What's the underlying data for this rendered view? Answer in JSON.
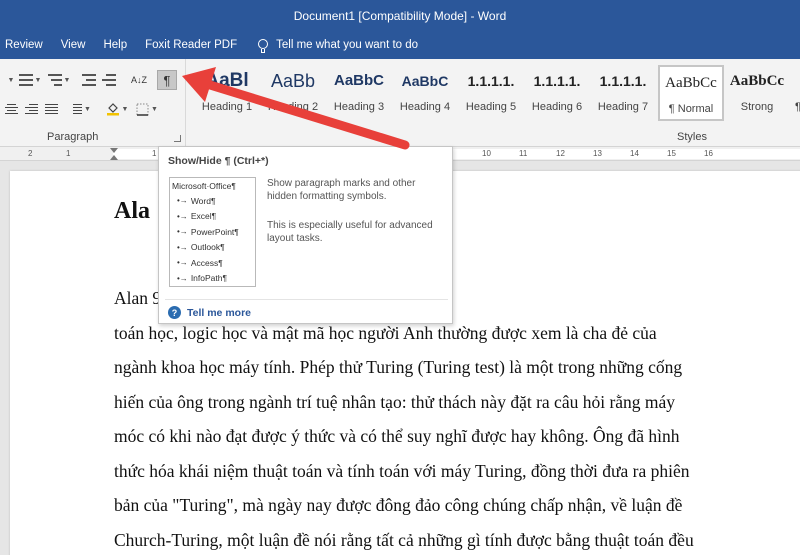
{
  "window": {
    "title": "Document1 [Compatibility Mode]  -  Word"
  },
  "menu": {
    "items": [
      "Review",
      "View",
      "Help",
      "Foxit Reader PDF"
    ],
    "tell_me": "Tell me what you want to do"
  },
  "ribbon": {
    "paragraph_label": "Paragraph",
    "sort_label": "A↓Z",
    "pilcrow": "¶",
    "styles_label": "Styles",
    "styles": [
      {
        "sample": "AaBl",
        "name": "Heading 1"
      },
      {
        "sample": "AaBb",
        "name": "Heading 2"
      },
      {
        "sample": "AaBbC",
        "name": "Heading 3"
      },
      {
        "sample": "AaBbC",
        "name": "Heading 4"
      },
      {
        "sample": "1.1.1.1.",
        "name": "Heading 5"
      },
      {
        "sample": "1.1.1.1.",
        "name": "Heading 6"
      },
      {
        "sample": "1.1.1.1.",
        "name": "Heading 7"
      },
      {
        "sample": "AaBbCc",
        "name": "¶ Normal"
      },
      {
        "sample": "AaBbCc",
        "name": "Strong"
      },
      {
        "sample": "",
        "name": "¶"
      }
    ]
  },
  "ruler": {
    "numbers": [
      "2",
      "1",
      "1",
      "2",
      "3",
      "4",
      "5",
      "6",
      "7",
      "8",
      "9",
      "10",
      "11",
      "12",
      "13",
      "14",
      "15",
      "16"
    ]
  },
  "tooltip": {
    "title": "Show/Hide ¶ (Ctrl+*)",
    "preview_head": "Microsoft·Office¶",
    "preview_items": [
      "Word¶",
      "Excel¶",
      "PowerPoint¶",
      "Outlook¶",
      "Access¶",
      "InfoPath¶"
    ],
    "description": "Show paragraph marks and other hidden formatting symbols.",
    "description2": "This is especially useful for advanced layout tasks.",
    "help": "Tell me more"
  },
  "document": {
    "heading": "Ala",
    "lines": [
      "Alan                                          912 – 7 tháng 6 năm 1954) là một nhà",
      "toán học, logic học và mật mã học người Anh thường được xem là cha đẻ của",
      "ngành khoa học máy tính. Phép thử Turing (Turing test) là một trong những cống",
      "hiến của ông trong ngành trí tuệ nhân tạo: thử thách này đặt ra câu hỏi rằng máy",
      "móc có khi nào đạt được ý thức và có thể suy nghĩ được hay không. Ông đã hình",
      "thức hóa khái niệm thuật toán và tính toán với máy Turing, đồng thời đưa ra phiên",
      "bản của \"Turing\", mà ngày nay được đông đảo công chúng chấp nhận, về luận đề",
      "Church-Turing, một luận đề nói rằng tất cả những gì tính được bằng thuật toán đều"
    ]
  },
  "colors": {
    "word_blue": "#2b579a",
    "arrow_red": "#e8403a"
  },
  "annotation": {
    "type": "arrow",
    "points_to": "show-hide-button"
  }
}
